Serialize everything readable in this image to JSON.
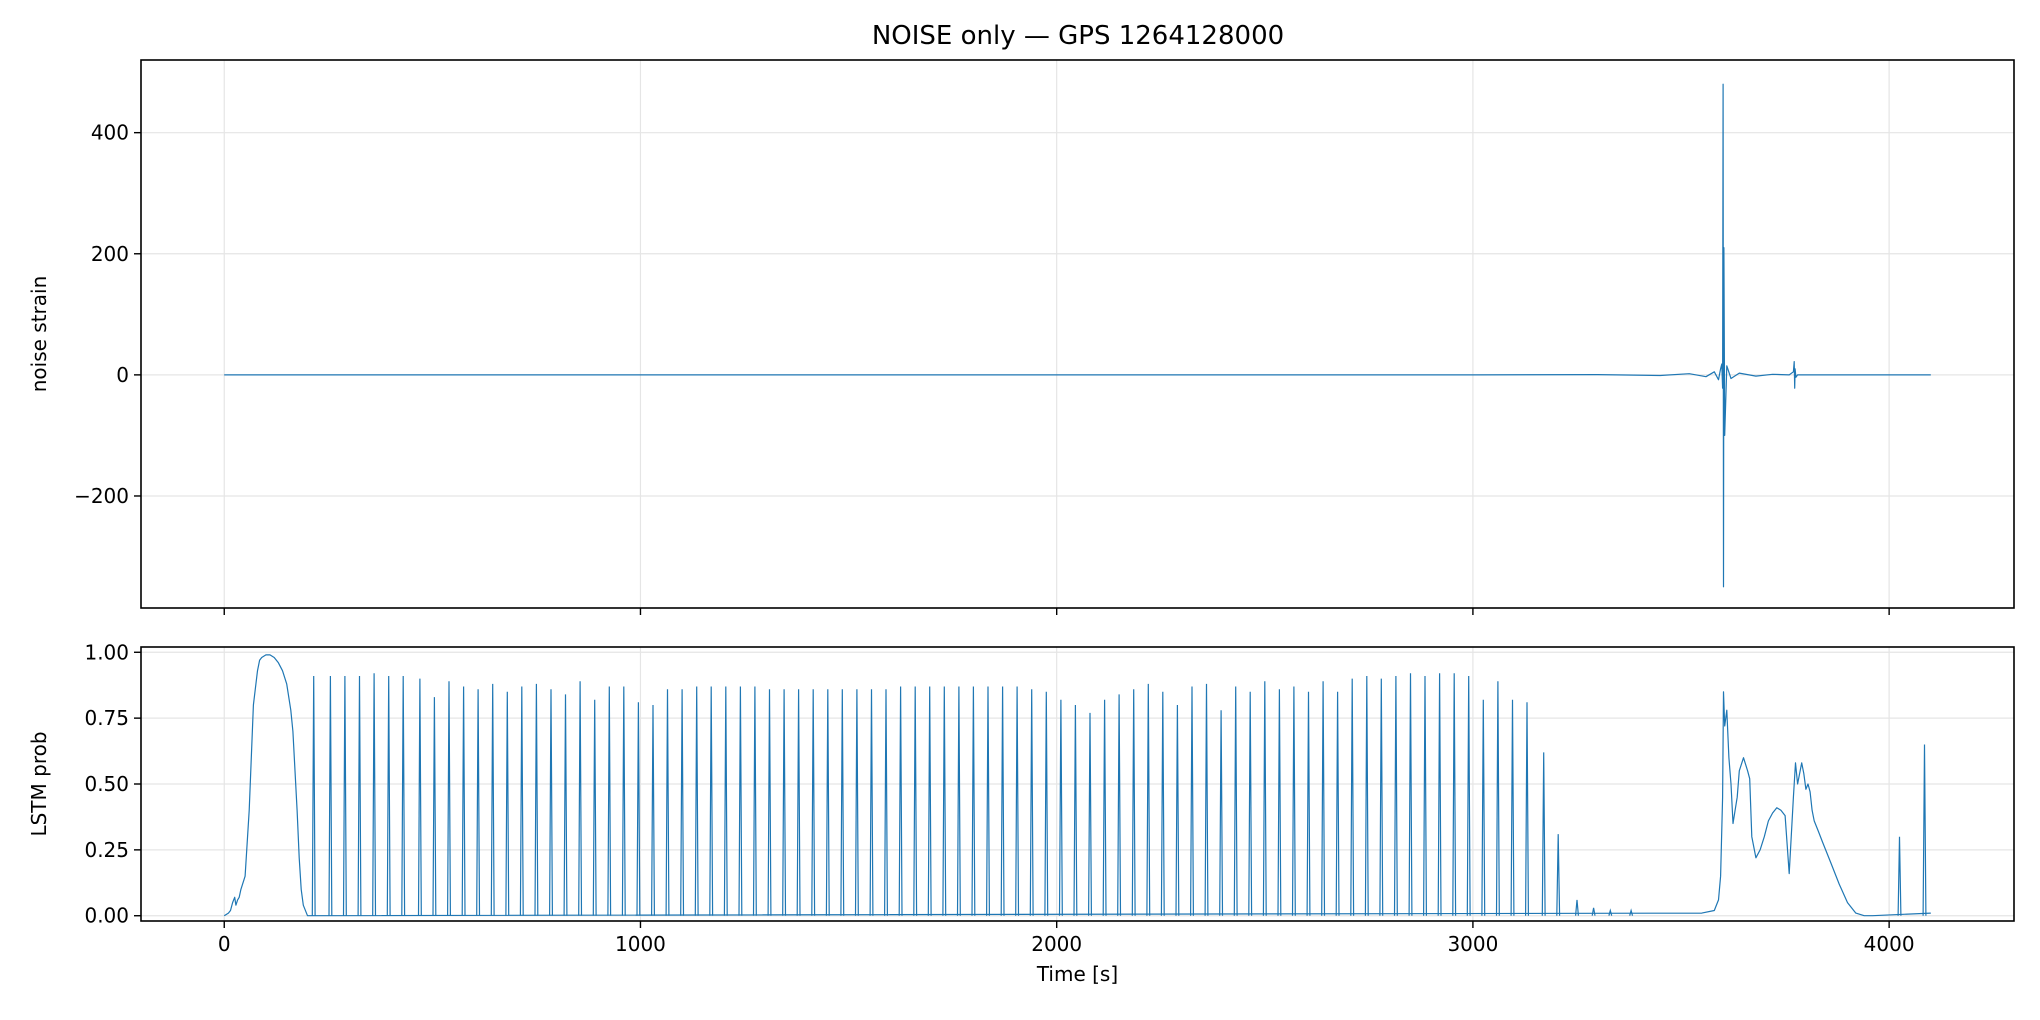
{
  "title": "NOISE only — GPS 1264128000",
  "colors": {
    "line": "#1f77b4",
    "grid": "#e5e5e5",
    "axis": "#000000"
  },
  "chart_data": [
    {
      "type": "line",
      "name": "top-panel",
      "title": "NOISE only — GPS 1264128000",
      "xlabel": "",
      "ylabel": "noise strain",
      "xlim": [
        -200,
        4300
      ],
      "ylim": [
        -385,
        520
      ],
      "xticks": [
        0,
        1000,
        2000,
        3000,
        4000
      ],
      "xtick_labels_visible": false,
      "yticks": [
        -200,
        0,
        200,
        400
      ],
      "ytick_labels": [
        "−200",
        "0",
        "200",
        "400"
      ],
      "grid": true,
      "legend": "none",
      "series": [
        {
          "x": [
            0,
            1000,
            2000,
            3000,
            3300,
            3450,
            3520,
            3560,
            3580,
            3590,
            3595,
            3598,
            3600,
            3601,
            3602,
            3603,
            3605,
            3610,
            3620,
            3640,
            3680,
            3720,
            3760,
            3770,
            3772,
            3773,
            3774,
            3776,
            3780,
            3850,
            4000,
            4100
          ],
          "y": [
            0,
            0,
            0,
            0,
            0.5,
            -1,
            2,
            -3,
            5,
            -8,
            10,
            18,
            -22,
            480,
            -350,
            210,
            -100,
            15,
            -6,
            3,
            -2,
            1,
            0,
            5,
            22,
            -22,
            10,
            -4,
            0,
            0,
            0,
            0
          ]
        }
      ]
    },
    {
      "type": "line",
      "name": "bottom-panel",
      "title": "",
      "xlabel": "Time [s]",
      "ylabel": "LSTM prob",
      "xlim": [
        -200,
        4300
      ],
      "ylim": [
        -0.02,
        1.02
      ],
      "xticks": [
        0,
        1000,
        2000,
        3000,
        4000
      ],
      "xtick_labels": [
        "0",
        "1000",
        "2000",
        "3000",
        "4000"
      ],
      "yticks": [
        0.0,
        0.25,
        0.5,
        0.75,
        1.0
      ],
      "ytick_labels": [
        "0.00",
        "0.25",
        "0.50",
        "0.75",
        "1.00"
      ],
      "grid": true,
      "legend": "none",
      "series": [
        {
          "x": [
            0,
            10,
            15,
            20,
            25,
            28,
            32,
            36,
            40,
            50,
            60,
            70,
            80,
            85,
            90,
            100,
            110,
            120,
            130,
            140,
            150,
            160,
            165,
            170,
            175,
            180,
            185,
            190,
            200,
            3550,
            3580,
            3590,
            3595,
            3600,
            3602,
            3605,
            3610,
            3615,
            3620,
            3625,
            3630,
            3635,
            3640,
            3650,
            3660,
            3665,
            3670,
            3680,
            3690,
            3700,
            3710,
            3720,
            3730,
            3740,
            3750,
            3760,
            3770,
            3775,
            3780,
            3790,
            3795,
            3800,
            3805,
            3810,
            3815,
            3820,
            3830,
            3840,
            3860,
            3880,
            3900,
            3920,
            3940,
            3960,
            4100
          ],
          "y": [
            0.0,
            0.01,
            0.02,
            0.05,
            0.07,
            0.04,
            0.06,
            0.07,
            0.1,
            0.15,
            0.4,
            0.8,
            0.93,
            0.97,
            0.98,
            0.99,
            0.99,
            0.98,
            0.96,
            0.93,
            0.88,
            0.78,
            0.7,
            0.55,
            0.4,
            0.22,
            0.1,
            0.04,
            0.0,
            0.01,
            0.02,
            0.06,
            0.15,
            0.45,
            0.85,
            0.72,
            0.78,
            0.6,
            0.5,
            0.35,
            0.4,
            0.45,
            0.55,
            0.6,
            0.55,
            0.52,
            0.3,
            0.22,
            0.25,
            0.3,
            0.36,
            0.39,
            0.41,
            0.4,
            0.38,
            0.16,
            0.45,
            0.58,
            0.5,
            0.58,
            0.54,
            0.48,
            0.5,
            0.47,
            0.4,
            0.36,
            0.32,
            0.28,
            0.2,
            0.12,
            0.05,
            0.01,
            0.0,
            0.0,
            0.01
          ]
        }
      ],
      "spikes": {
        "x": [
          215,
          255,
          290,
          325,
          360,
          395,
          430,
          470,
          505,
          540,
          575,
          610,
          645,
          680,
          715,
          750,
          785,
          820,
          855,
          890,
          925,
          960,
          995,
          1030,
          1065,
          1100,
          1135,
          1170,
          1205,
          1240,
          1275,
          1310,
          1345,
          1380,
          1415,
          1450,
          1485,
          1520,
          1555,
          1590,
          1625,
          1660,
          1695,
          1730,
          1765,
          1800,
          1835,
          1870,
          1905,
          1940,
          1975,
          2010,
          2045,
          2080,
          2115,
          2150,
          2185,
          2220,
          2255,
          2290,
          2325,
          2360,
          2395,
          2430,
          2465,
          2500,
          2535,
          2570,
          2605,
          2640,
          2675,
          2710,
          2745,
          2780,
          2815,
          2850,
          2885,
          2920,
          2955,
          2990,
          3025,
          3060,
          3095,
          3130,
          3170,
          3205,
          3250,
          3290,
          3330,
          3380,
          4025,
          4085
        ],
        "y": [
          0.91,
          0.91,
          0.91,
          0.91,
          0.92,
          0.91,
          0.91,
          0.9,
          0.83,
          0.89,
          0.87,
          0.86,
          0.88,
          0.85,
          0.87,
          0.88,
          0.86,
          0.84,
          0.89,
          0.82,
          0.87,
          0.87,
          0.81,
          0.8,
          0.86,
          0.86,
          0.87,
          0.87,
          0.87,
          0.87,
          0.87,
          0.86,
          0.86,
          0.86,
          0.86,
          0.86,
          0.86,
          0.86,
          0.86,
          0.86,
          0.87,
          0.87,
          0.87,
          0.87,
          0.87,
          0.87,
          0.87,
          0.87,
          0.87,
          0.86,
          0.85,
          0.82,
          0.8,
          0.77,
          0.82,
          0.84,
          0.86,
          0.88,
          0.85,
          0.8,
          0.87,
          0.88,
          0.78,
          0.87,
          0.85,
          0.89,
          0.86,
          0.87,
          0.85,
          0.89,
          0.85,
          0.9,
          0.91,
          0.9,
          0.91,
          0.92,
          0.91,
          0.92,
          0.92,
          0.91,
          0.82,
          0.89,
          0.82,
          0.81,
          0.62,
          0.31,
          0.06,
          0.03,
          0.02,
          0.02,
          0.3,
          0.65
        ]
      }
    }
  ]
}
